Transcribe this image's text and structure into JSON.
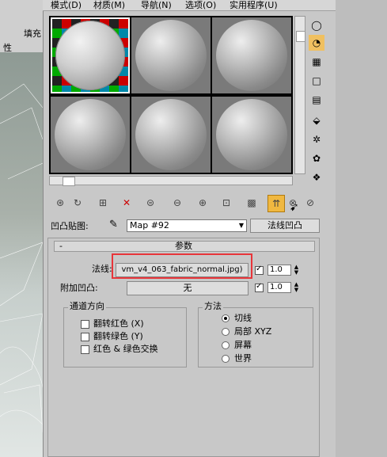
{
  "menu": [
    "模式(D)",
    "材质(M)",
    "导航(N)",
    "选项(O)",
    "实用程序(U)"
  ],
  "bg": {
    "fill_label": "填充",
    "prop_label": "性"
  },
  "map_row": {
    "label": "凹凸贴图:",
    "map_name": "Map #92",
    "type_button": "法线凹凸"
  },
  "rollout": {
    "title": "参数",
    "collapse_mark": "-"
  },
  "normal": {
    "label": "法线:",
    "file_button": "vm_v4_063_fabric_normal.jpg)",
    "amount": "1.0"
  },
  "bump": {
    "label": "附加凹凸:",
    "button": "无",
    "amount": "1.0"
  },
  "channel": {
    "title": "通道方向",
    "options": [
      "翻转红色 (X)",
      "翻转绿色 (Y)",
      "红色 & 绿色交换"
    ]
  },
  "method": {
    "title": "方法",
    "options": [
      "切线",
      "局部 XYZ",
      "屏幕",
      "世界"
    ],
    "selected": "切线"
  }
}
